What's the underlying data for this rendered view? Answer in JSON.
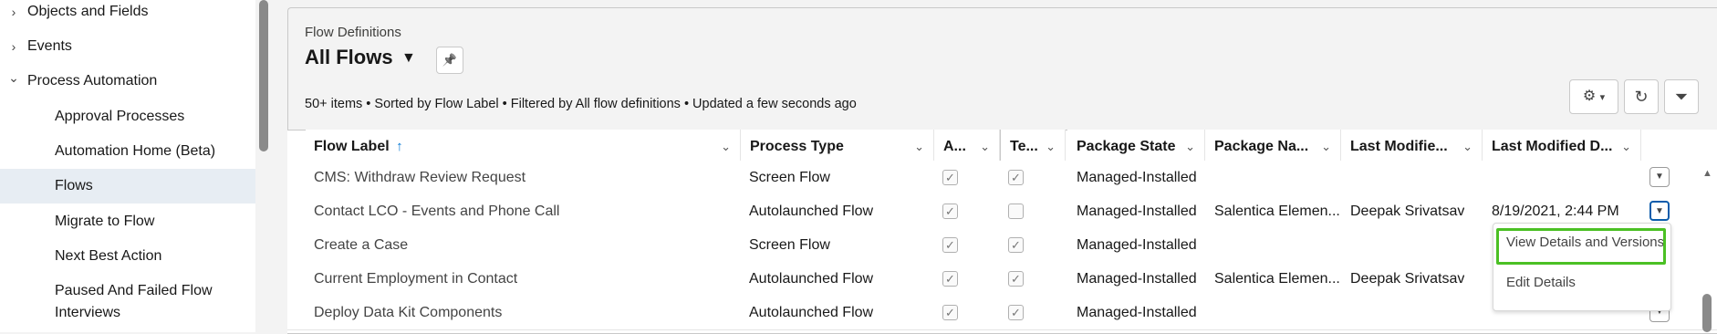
{
  "sidebar": {
    "items": [
      {
        "label": "Objects and Fields",
        "chevron": "›"
      },
      {
        "label": "Events",
        "chevron": "›"
      },
      {
        "label": "Process Automation",
        "chevron": "⌄"
      },
      {
        "label": "Approval Processes"
      },
      {
        "label": "Automation Home (Beta)"
      },
      {
        "label": "Flows"
      },
      {
        "label": "Migrate to Flow"
      },
      {
        "label": "Next Best Action"
      },
      {
        "label": "Paused And Failed Flow"
      },
      {
        "label": "Interviews"
      }
    ]
  },
  "header": {
    "object_label": "Flow Definitions",
    "list_view": "All Flows",
    "dropdown_icon": "▼",
    "pin_icon": "📌",
    "summary": "50+ items • Sorted by Flow Label • Filtered by All flow definitions • Updated a few seconds ago",
    "settings_icon": "⚙",
    "settings_caret": "▾",
    "refresh_icon": "↻",
    "filter_icon": "⏷"
  },
  "table": {
    "columns": [
      {
        "label": "Flow Label",
        "sort_icon": "↑"
      },
      {
        "label": "Process Type"
      },
      {
        "label": "A..."
      },
      {
        "label": "Te..."
      },
      {
        "label": "Package State"
      },
      {
        "label": "Package Na..."
      },
      {
        "label": "Last Modifie..."
      },
      {
        "label": "Last Modified D..."
      }
    ],
    "header_chevron": "⌄",
    "check": "✓",
    "row_action_icon": "▼",
    "rows": [
      {
        "flow_label": "CMS: Withdraw Review Request",
        "process_type": "Screen Flow",
        "active": true,
        "template": true,
        "package_state": "Managed-Installed",
        "package_name": "",
        "last_modified_by": "",
        "last_modified_date": ""
      },
      {
        "flow_label": "Contact LCO - Events and Phone Call",
        "process_type": "Autolaunched Flow",
        "active": true,
        "template": false,
        "package_state": "Managed-Installed",
        "package_name": "Salentica Elemen...",
        "last_modified_by": "Deepak Srivatsav",
        "last_modified_date": "8/19/2021, 2:44 PM"
      },
      {
        "flow_label": "Create a Case",
        "process_type": "Screen Flow",
        "active": true,
        "template": true,
        "package_state": "Managed-Installed",
        "package_name": "",
        "last_modified_by": "",
        "last_modified_date": ""
      },
      {
        "flow_label": "Current Employment in Contact",
        "process_type": "Autolaunched Flow",
        "active": true,
        "template": true,
        "package_state": "Managed-Installed",
        "package_name": "Salentica Elemen...",
        "last_modified_by": "Deepak Srivatsav",
        "last_modified_date": ""
      },
      {
        "flow_label": "Deploy Data Kit Components",
        "process_type": "Autolaunched Flow",
        "active": true,
        "template": true,
        "package_state": "Managed-Installed",
        "package_name": "",
        "last_modified_by": "",
        "last_modified_date": ""
      }
    ]
  },
  "row_menu": {
    "items": [
      {
        "label": "View Details and Versions"
      },
      {
        "label": "Edit Details"
      }
    ]
  },
  "scroll": {
    "up_icon": "▲"
  },
  "colors": {
    "focus_outline": "#4bc024",
    "sort_arrow": "#0176d3",
    "selected_nav": "#e7edf3"
  }
}
